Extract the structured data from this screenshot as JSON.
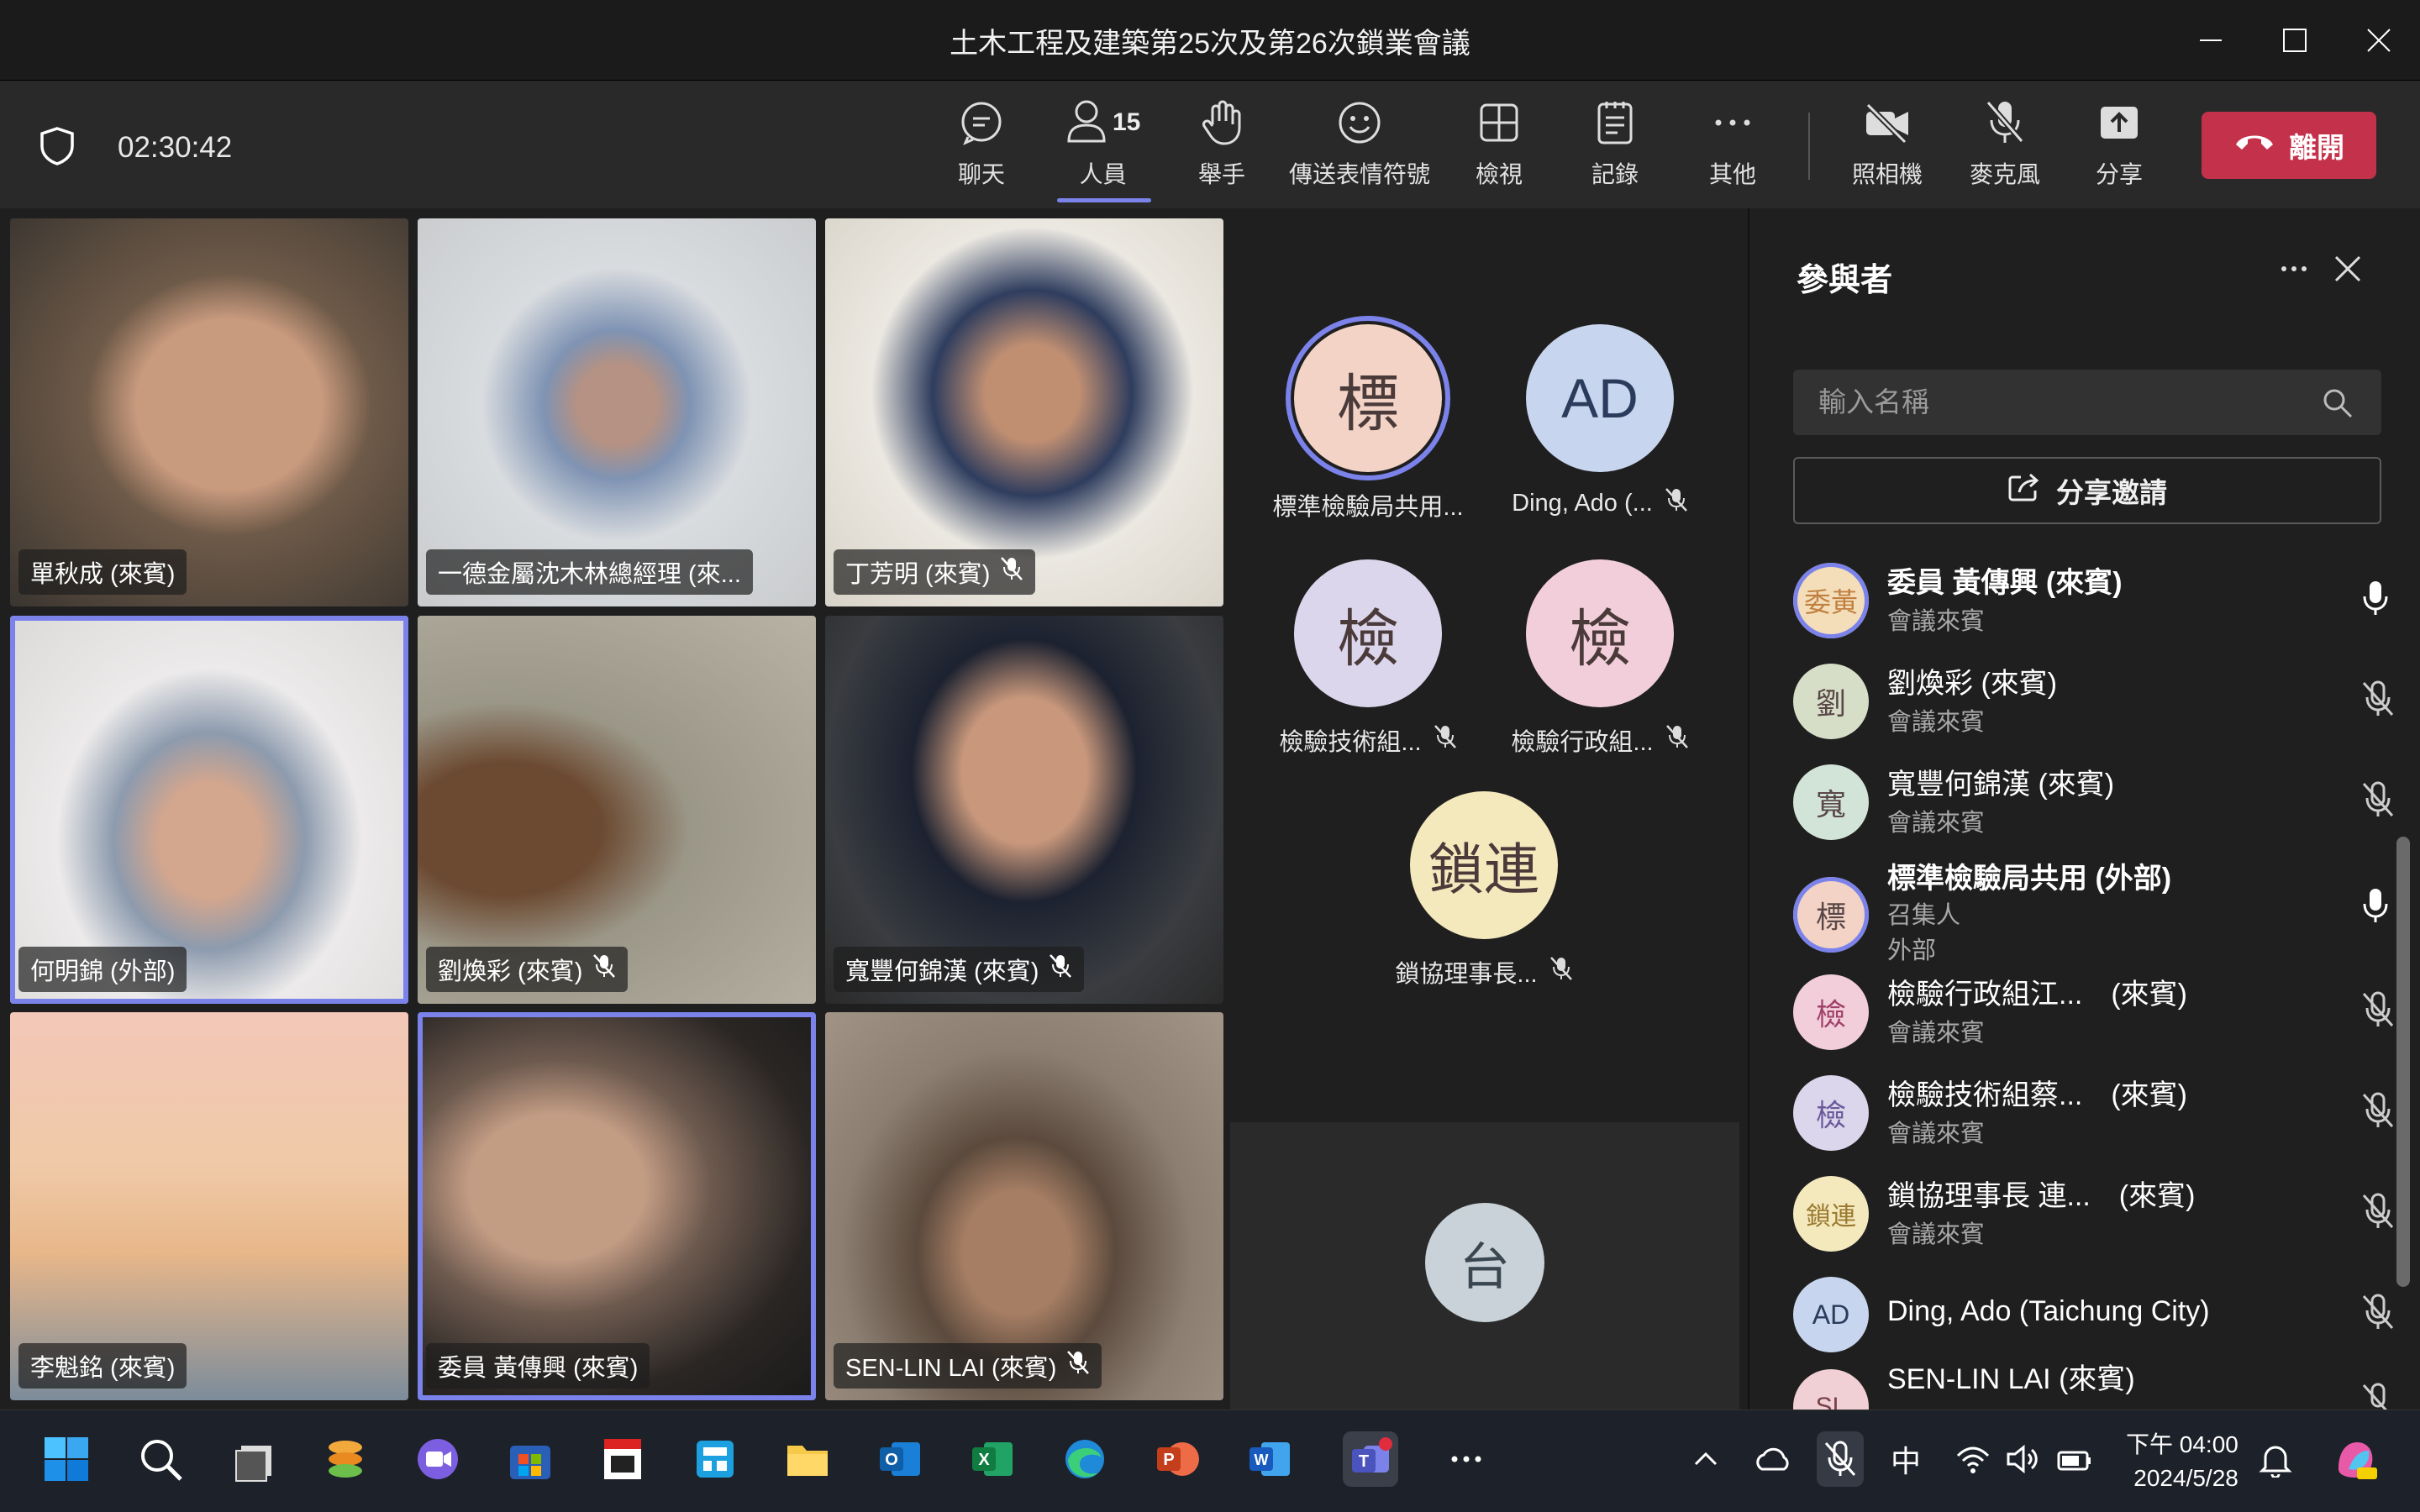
{
  "window": {
    "title": "土木工程及建築第25次及第26次鎖業會議"
  },
  "toolbar": {
    "timer": "02:30:42",
    "people_count": "15",
    "buttons": {
      "chat": "聊天",
      "people": "人員",
      "raise_hand": "舉手",
      "reactions": "傳送表情符號",
      "view": "檢視",
      "notes": "記錄",
      "more": "其他",
      "camera": "照相機",
      "mic": "麥克風",
      "share": "分享"
    },
    "leave": "離開"
  },
  "video_tiles": [
    {
      "name": "單秋成 (來賓)",
      "muted": false
    },
    {
      "name": "一德金屬沈木林總經理 (來...",
      "muted": false
    },
    {
      "name": "丁芳明 (來賓)",
      "muted": true
    },
    {
      "name": "何明錦 (外部)",
      "muted": false
    },
    {
      "name": "劉煥彩 (來賓)",
      "muted": true
    },
    {
      "name": "寬豐何錦漢 (來賓)",
      "muted": true
    },
    {
      "name": "李魁銘 (來賓)",
      "muted": false
    },
    {
      "name": "委員 黃傳興 (來賓)",
      "muted": false
    },
    {
      "name": "SEN-LIN LAI (來賓)",
      "muted": true
    }
  ],
  "avatars": [
    {
      "initials": "標",
      "label": "標準檢驗局共用...",
      "color": "#f2d3c5"
    },
    {
      "initials": "AD",
      "label": "Ding, Ado (...",
      "color": "#c7d6ee"
    },
    {
      "initials": "檢",
      "label": "檢驗技術組...",
      "color": "#dcd6ec"
    },
    {
      "initials": "檢",
      "label": "檢驗行政組...",
      "color": "#f2cedb"
    },
    {
      "initials": "鎖連",
      "label": "鎖協理事長...",
      "color": "#f4e8bd"
    }
  ],
  "tai_avatar": {
    "initials": "台",
    "color": "#c8d2d8"
  },
  "panel": {
    "title": "參與者",
    "search_placeholder": "輸入名稱",
    "share_invite": "分享邀請",
    "participants": [
      {
        "initials": "委黃",
        "name": "委員 黃傳興 (來賓)",
        "sub": "會議來賓",
        "sub2": "",
        "color": "#f4ddb9",
        "mic": "on"
      },
      {
        "initials": "劉",
        "name": "劉煥彩 (來賓)",
        "sub": "會議來賓",
        "sub2": "",
        "color": "#d7dec8",
        "mic": "off"
      },
      {
        "initials": "寬",
        "name": "寬豐何錦漢 (來賓)",
        "sub": "會議來賓",
        "sub2": "",
        "color": "#d2e4d7",
        "mic": "off"
      },
      {
        "initials": "標",
        "name": "標準檢驗局共用 (外部)",
        "sub": "召集人",
        "sub2": "外部",
        "color": "#f2d3c5",
        "mic": "on"
      },
      {
        "initials": "檢",
        "name": "檢驗行政組江...　(來賓)",
        "sub": "會議來賓",
        "sub2": "",
        "color": "#f2cedb",
        "mic": "off"
      },
      {
        "initials": "檢",
        "name": "檢驗技術組蔡...　(來賓)",
        "sub": "會議來賓",
        "sub2": "",
        "color": "#dcd6ec",
        "mic": "off"
      },
      {
        "initials": "鎖連",
        "name": "鎖協理事長 連...　(來賓)",
        "sub": "會議來賓",
        "sub2": "",
        "color": "#f4e8bd",
        "mic": "off"
      },
      {
        "initials": "AD",
        "name": "Ding, Ado (Taichung City)",
        "sub": "",
        "sub2": "",
        "color": "#c7d6ee",
        "mic": "off"
      },
      {
        "initials": "SL",
        "name": "SEN-LIN LAI (來賓)",
        "sub": "",
        "sub2": "",
        "color": "#f0d0d4",
        "mic": "off"
      }
    ]
  },
  "taskbar": {
    "time": "下午 04:00",
    "date": "2024/5/28",
    "ime": "中"
  }
}
